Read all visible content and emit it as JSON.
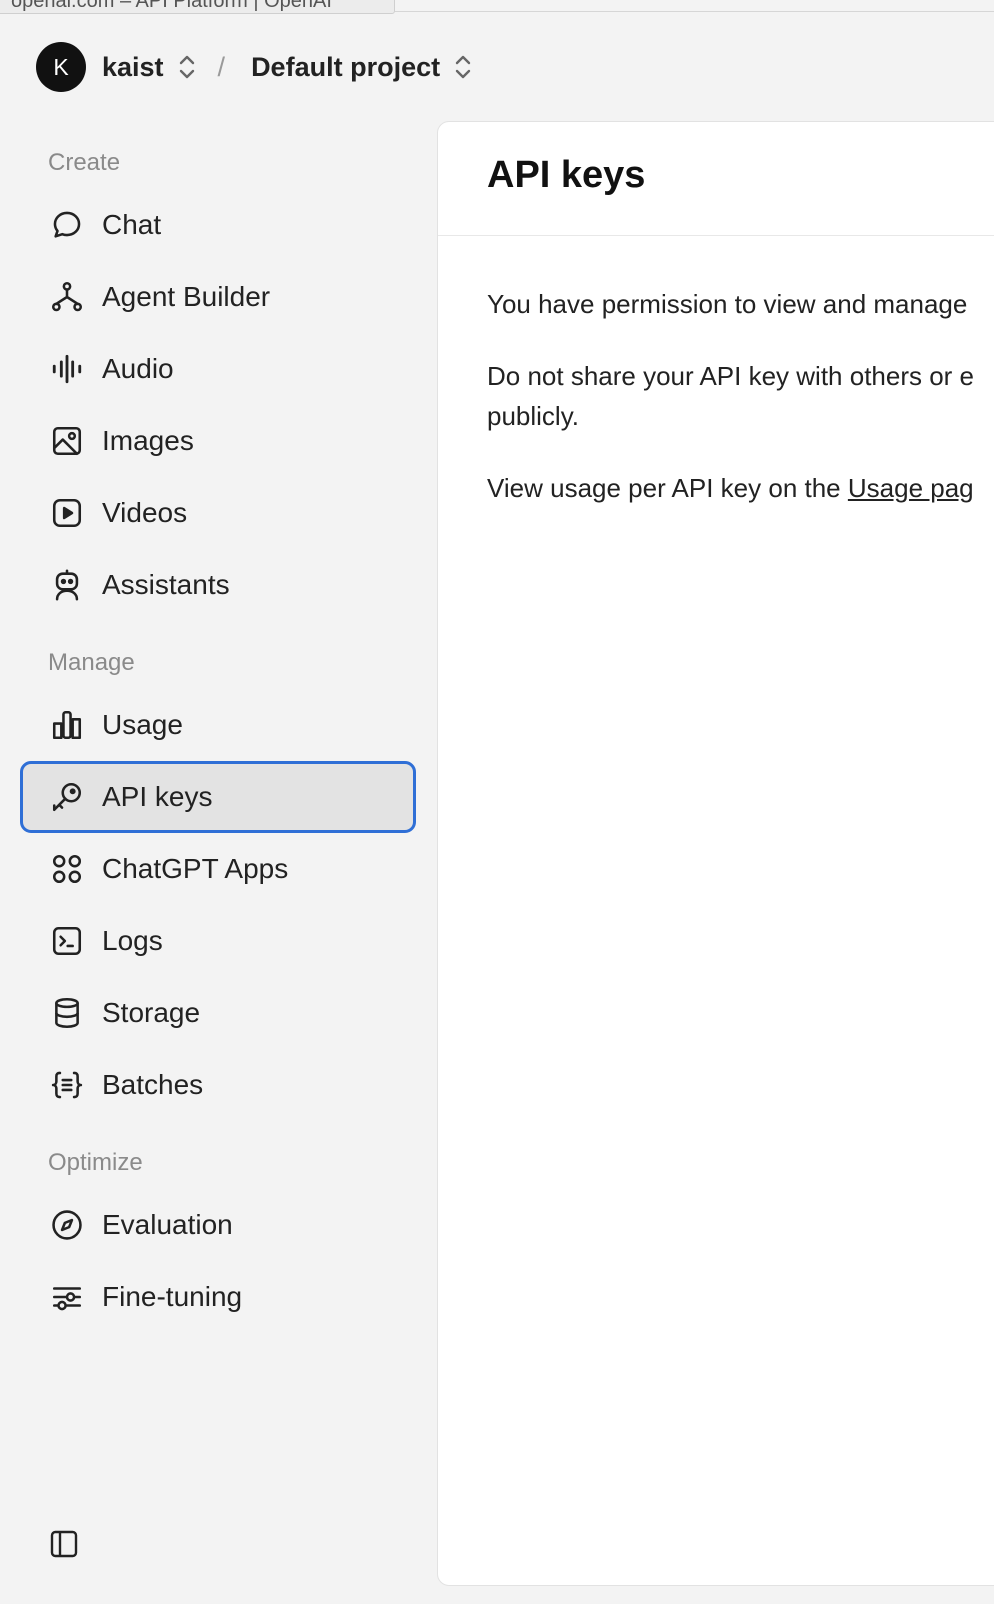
{
  "browser": {
    "tab_tooltip": "openai.com – API Platform | OpenAI"
  },
  "header": {
    "org_initial": "K",
    "org_name": "kaist",
    "separator": "/",
    "project_name": "Default project"
  },
  "sidebar": {
    "sections": {
      "create": "Create",
      "manage": "Manage",
      "optimize": "Optimize"
    },
    "create_items": [
      {
        "label": "Chat",
        "icon": "chat-bubble-icon"
      },
      {
        "label": "Agent Builder",
        "icon": "agent-builder-icon"
      },
      {
        "label": "Audio",
        "icon": "audio-waveform-icon"
      },
      {
        "label": "Images",
        "icon": "image-icon"
      },
      {
        "label": "Videos",
        "icon": "video-play-icon"
      },
      {
        "label": "Assistants",
        "icon": "robot-icon"
      }
    ],
    "manage_items": [
      {
        "label": "Usage",
        "icon": "bar-chart-icon"
      },
      {
        "label": "API keys",
        "icon": "key-icon",
        "active": true
      },
      {
        "label": "ChatGPT Apps",
        "icon": "apps-grid-icon"
      },
      {
        "label": "Logs",
        "icon": "terminal-icon"
      },
      {
        "label": "Storage",
        "icon": "database-icon"
      },
      {
        "label": "Batches",
        "icon": "braces-icon"
      }
    ],
    "optimize_items": [
      {
        "label": "Evaluation",
        "icon": "compass-icon"
      },
      {
        "label": "Fine-tuning",
        "icon": "sliders-icon"
      }
    ],
    "collapse_icon": "sidebar-toggle-icon"
  },
  "main": {
    "title": "API keys",
    "paragraph1": "You have permission to view and manage",
    "paragraph2_line1": "Do not share your API key with others or e",
    "paragraph2_line2": "publicly.",
    "paragraph3_prefix": "View usage per API key on the ",
    "usage_link": "Usage pag"
  },
  "colors": {
    "active_border": "#2f6fd6",
    "active_bg": "#e3e3e3",
    "sidebar_bg": "#f3f3f3"
  }
}
